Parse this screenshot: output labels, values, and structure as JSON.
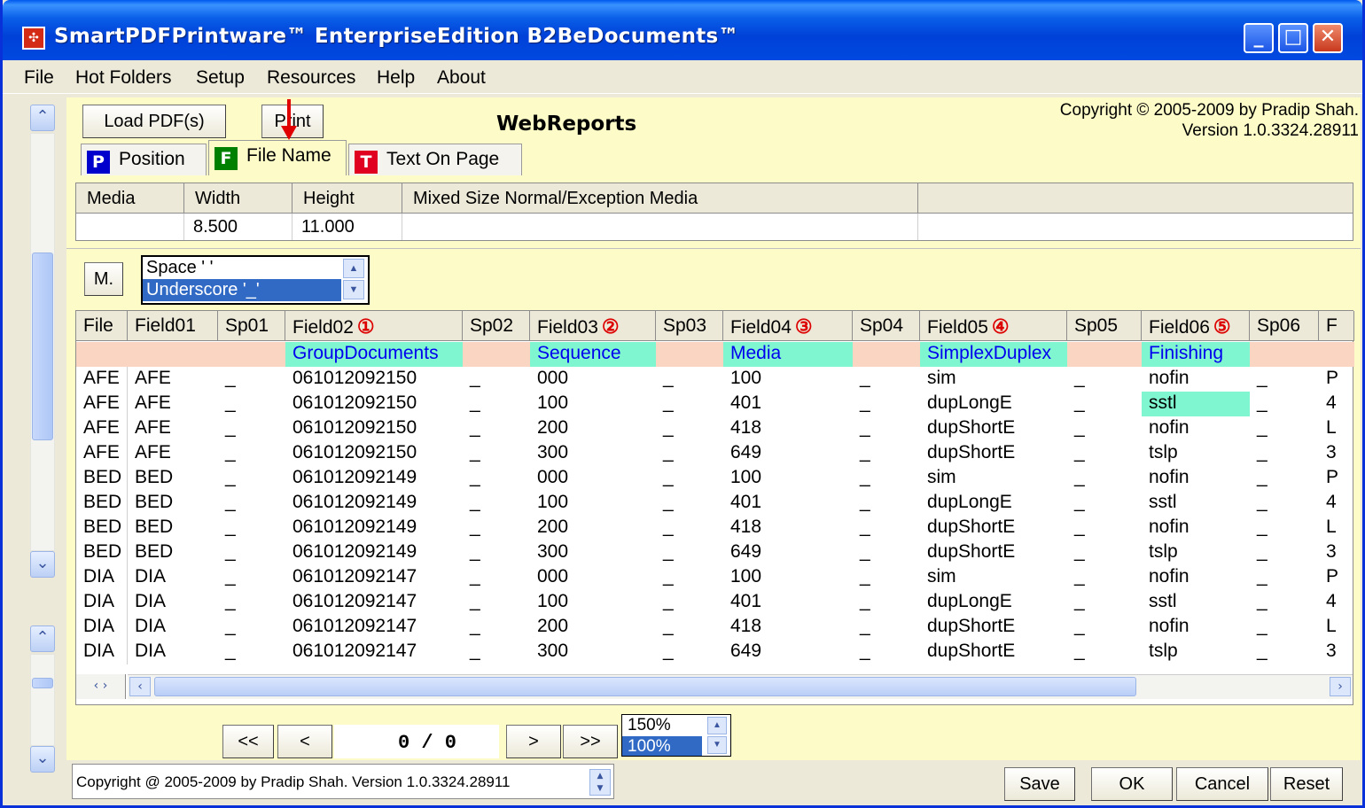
{
  "window": {
    "title": "SmartPDFPrintware™ EnterpriseEdition B2BeDocuments™",
    "icon": "app-logo-icon"
  },
  "menu": [
    "File",
    "Hot Folders",
    "Setup",
    "Resources",
    "Help",
    "About"
  ],
  "toolbar": {
    "load_label": "Load PDF(s)",
    "print_label": "Print",
    "app_label": "WebReports"
  },
  "copyright": {
    "line1": "Copyright © 2005-2009 by Pradip Shah.",
    "line2": "Version 1.0.3324.28911"
  },
  "tabs": [
    {
      "badge": "P",
      "label": "Position",
      "color": "#0000cc"
    },
    {
      "badge": "F",
      "label": "File Name",
      "color": "#008000"
    },
    {
      "badge": "T",
      "label": "Text On Page",
      "color": "#e00020"
    }
  ],
  "media_table": {
    "headers": [
      "Media",
      "Width",
      "Height",
      "Mixed Size Normal/Exception Media"
    ],
    "row": [
      "",
      "8.500",
      "11.000",
      ""
    ]
  },
  "m_button": "M.",
  "separator_options": [
    "Space ' '",
    "Underscore '_'"
  ],
  "separator_selected": "Underscore '_'",
  "grid": {
    "headers": [
      "File",
      "Field01",
      "Sp01",
      "Field02",
      "Sp02",
      "Field03",
      "Sp03",
      "Field04",
      "Sp04",
      "Field05",
      "Sp05",
      "Field06",
      "Sp06",
      "F"
    ],
    "markers": {
      "Field02": "①",
      "Field03": "②",
      "Field04": "③",
      "Field05": "④",
      "Field06": "⑤"
    },
    "labels": {
      "Field02": "GroupDocuments",
      "Field03": "Sequence",
      "Field04": "Media",
      "Field05": "SimplexDuplex",
      "Field06": "Finishing"
    },
    "rows": [
      [
        "AFE",
        "AFE",
        "_",
        "061012092150",
        "_",
        "000",
        "_",
        "100",
        "_",
        "sim",
        "_",
        "nofin",
        "_",
        "P"
      ],
      [
        "AFE",
        "AFE",
        "_",
        "061012092150",
        "_",
        "100",
        "_",
        "401",
        "_",
        "dupLongE",
        "_",
        "sstl",
        "_",
        "4"
      ],
      [
        "AFE",
        "AFE",
        "_",
        "061012092150",
        "_",
        "200",
        "_",
        "418",
        "_",
        "dupShortE",
        "_",
        "nofin",
        "_",
        "L"
      ],
      [
        "AFE",
        "AFE",
        "_",
        "061012092150",
        "_",
        "300",
        "_",
        "649",
        "_",
        "dupShortE",
        "_",
        "tslp",
        "_",
        "3"
      ],
      [
        "BED",
        "BED",
        "_",
        "061012092149",
        "_",
        "000",
        "_",
        "100",
        "_",
        "sim",
        "_",
        "nofin",
        "_",
        "P"
      ],
      [
        "BED",
        "BED",
        "_",
        "061012092149",
        "_",
        "100",
        "_",
        "401",
        "_",
        "dupLongE",
        "_",
        "sstl",
        "_",
        "4"
      ],
      [
        "BED",
        "BED",
        "_",
        "061012092149",
        "_",
        "200",
        "_",
        "418",
        "_",
        "dupShortE",
        "_",
        "nofin",
        "_",
        "L"
      ],
      [
        "BED",
        "BED",
        "_",
        "061012092149",
        "_",
        "300",
        "_",
        "649",
        "_",
        "dupShortE",
        "_",
        "tslp",
        "_",
        "3"
      ],
      [
        "DIA",
        "DIA",
        "_",
        "061012092147",
        "_",
        "000",
        "_",
        "100",
        "_",
        "sim",
        "_",
        "nofin",
        "_",
        "P"
      ],
      [
        "DIA",
        "DIA",
        "_",
        "061012092147",
        "_",
        "100",
        "_",
        "401",
        "_",
        "dupLongE",
        "_",
        "sstl",
        "_",
        "4"
      ],
      [
        "DIA",
        "DIA",
        "_",
        "061012092147",
        "_",
        "200",
        "_",
        "418",
        "_",
        "dupShortE",
        "_",
        "nofin",
        "_",
        "L"
      ],
      [
        "DIA",
        "DIA",
        "_",
        "061012092147",
        "_",
        "300",
        "_",
        "649",
        "_",
        "dupShortE",
        "_",
        "tslp",
        "_",
        "3"
      ]
    ]
  },
  "pager": {
    "first": "<<",
    "prev": "<",
    "page": "0 / 0",
    "next": ">",
    "last": ">>"
  },
  "zoom": {
    "options": [
      "150%",
      "100%"
    ],
    "selected": "100%"
  },
  "status_text": "Copyright @ 2005-2009 by Pradip Shah. Version 1.0.3324.28911",
  "actions": {
    "save": "Save",
    "ok": "OK",
    "cancel": "Cancel",
    "reset": "Reset"
  }
}
